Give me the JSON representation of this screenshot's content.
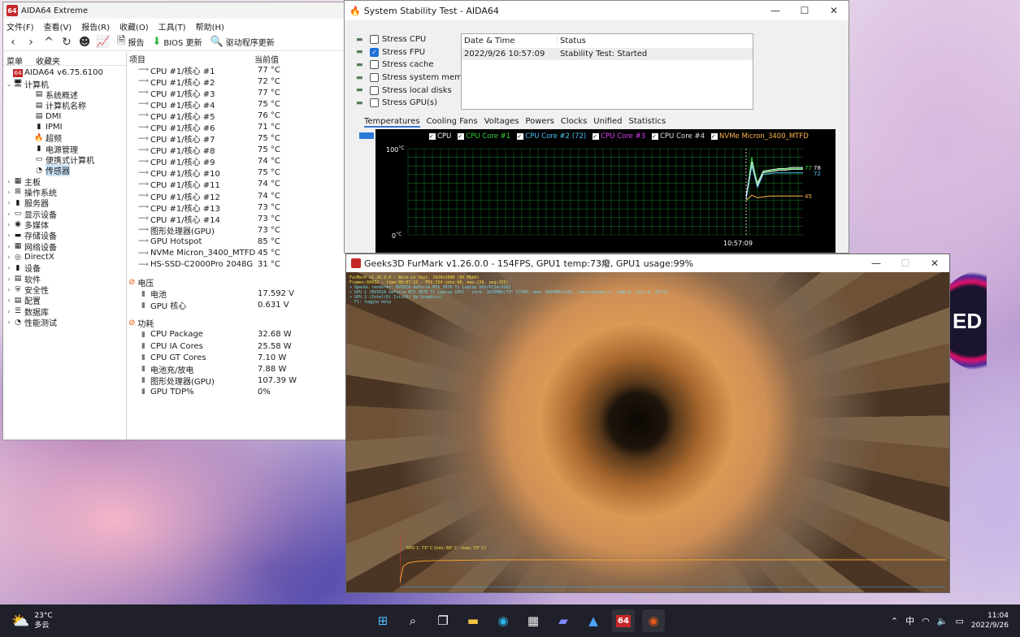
{
  "aida": {
    "title": "AIDA64 Extreme",
    "menu": [
      "文件(F)",
      "查看(V)",
      "报告(R)",
      "收藏(O)",
      "工具(T)",
      "帮助(H)"
    ],
    "toolbar": {
      "report": "报告",
      "bios": "BIOS 更新",
      "driver": "驱动程序更新"
    },
    "tabs": [
      "菜单",
      "收藏夹"
    ],
    "tree": [
      {
        "label": "AIDA64 v6.75.6100",
        "level": 0,
        "icon": "aida64-icon"
      },
      {
        "label": "计算机",
        "level": 0,
        "icon": "computer-icon",
        "expanded": true
      },
      {
        "label": "系统概述",
        "level": 1,
        "icon": "summary-icon"
      },
      {
        "label": "计算机名称",
        "level": 1,
        "icon": "computer-name-icon"
      },
      {
        "label": "DMI",
        "level": 1,
        "icon": "dmi-icon"
      },
      {
        "label": "IPMI",
        "level": 1,
        "icon": "ipmi-icon"
      },
      {
        "label": "超频",
        "level": 1,
        "icon": "overclock-icon"
      },
      {
        "label": "电源管理",
        "level": 1,
        "icon": "power-management-icon"
      },
      {
        "label": "便携式计算机",
        "level": 1,
        "icon": "laptop-icon"
      },
      {
        "label": "传感器",
        "level": 1,
        "icon": "sensor-icon",
        "selected": true
      },
      {
        "label": "主板",
        "level": 0,
        "icon": "motherboard-icon"
      },
      {
        "label": "操作系统",
        "level": 0,
        "icon": "windows-icon"
      },
      {
        "label": "服务器",
        "level": 0,
        "icon": "server-icon"
      },
      {
        "label": "显示设备",
        "level": 0,
        "icon": "display-icon"
      },
      {
        "label": "多媒体",
        "level": 0,
        "icon": "multimedia-icon"
      },
      {
        "label": "存储设备",
        "level": 0,
        "icon": "storage-icon"
      },
      {
        "label": "网络设备",
        "level": 0,
        "icon": "network-icon"
      },
      {
        "label": "DirectX",
        "level": 0,
        "icon": "directx-icon"
      },
      {
        "label": "设备",
        "level": 0,
        "icon": "devices-icon"
      },
      {
        "label": "软件",
        "level": 0,
        "icon": "software-icon"
      },
      {
        "label": "安全性",
        "level": 0,
        "icon": "security-icon"
      },
      {
        "label": "配置",
        "level": 0,
        "icon": "config-icon"
      },
      {
        "label": "数据库",
        "level": 0,
        "icon": "database-icon"
      },
      {
        "label": "性能测试",
        "level": 0,
        "icon": "benchmark-icon"
      }
    ],
    "columns": {
      "item": "项目",
      "value": "当前值"
    },
    "temps": [
      {
        "name": "CPU #1/核心 #1",
        "value": "77 °C"
      },
      {
        "name": "CPU #1/核心 #2",
        "value": "72 °C"
      },
      {
        "name": "CPU #1/核心 #3",
        "value": "77 °C"
      },
      {
        "name": "CPU #1/核心 #4",
        "value": "75 °C"
      },
      {
        "name": "CPU #1/核心 #5",
        "value": "76 °C"
      },
      {
        "name": "CPU #1/核心 #6",
        "value": "71 °C"
      },
      {
        "name": "CPU #1/核心 #7",
        "value": "75 °C"
      },
      {
        "name": "CPU #1/核心 #8",
        "value": "75 °C"
      },
      {
        "name": "CPU #1/核心 #9",
        "value": "74 °C"
      },
      {
        "name": "CPU #1/核心 #10",
        "value": "75 °C"
      },
      {
        "name": "CPU #1/核心 #11",
        "value": "74 °C"
      },
      {
        "name": "CPU #1/核心 #12",
        "value": "74 °C"
      },
      {
        "name": "CPU #1/核心 #13",
        "value": "73 °C"
      },
      {
        "name": "CPU #1/核心 #14",
        "value": "73 °C"
      },
      {
        "name": "图形处理器(GPU)",
        "value": "73 °C"
      },
      {
        "name": "GPU Hotspot",
        "value": "85 °C"
      },
      {
        "name": "NVMe Micron_3400_MTFD",
        "value": "45 °C"
      },
      {
        "name": "HS-SSD-C2000Pro 2048G",
        "value": "31 °C"
      }
    ],
    "voltage_section": "电压",
    "voltages": [
      {
        "name": "电池",
        "value": "17.592 V"
      },
      {
        "name": "GPU 核心",
        "value": "0.631 V"
      }
    ],
    "power_section": "功耗",
    "power": [
      {
        "name": "CPU Package",
        "value": "32.68 W"
      },
      {
        "name": "CPU IA Cores",
        "value": "25.58 W"
      },
      {
        "name": "CPU GT Cores",
        "value": "7.10 W"
      },
      {
        "name": "电池充/放电",
        "value": "7.88 W"
      },
      {
        "name": "图形处理器(GPU)",
        "value": "107.39 W"
      },
      {
        "name": "GPU TDP%",
        "value": "0%"
      }
    ]
  },
  "sst": {
    "title": "System Stability Test - AIDA64",
    "stress": [
      {
        "label": "Stress CPU",
        "checked": false
      },
      {
        "label": "Stress FPU",
        "checked": true
      },
      {
        "label": "Stress cache",
        "checked": false
      },
      {
        "label": "Stress system memory",
        "checked": false
      },
      {
        "label": "Stress local disks",
        "checked": false
      },
      {
        "label": "Stress GPU(s)",
        "checked": false
      }
    ],
    "table_headers": [
      "Date & Time",
      "Status"
    ],
    "table_row": [
      "2022/9/26 10:57:09",
      "Stability Test: Started"
    ],
    "tabs": [
      "Temperatures",
      "Cooling Fans",
      "Voltages",
      "Powers",
      "Clocks",
      "Unified",
      "Statistics"
    ],
    "legend": [
      {
        "label": "CPU",
        "color": "#ffffff"
      },
      {
        "label": "CPU Core #1",
        "color": "#36d43c"
      },
      {
        "label": "CPU Core #2 (72)",
        "color": "#4fc3f7"
      },
      {
        "label": "CPU Core #3",
        "color": "#e040fb"
      },
      {
        "label": "CPU Core #4",
        "color": "#e0e0e0"
      },
      {
        "label": "NVMe Micron_3400_MTFD",
        "color": "#ffb74d"
      }
    ],
    "chart": {
      "ytop": "100",
      "ybottom": "0",
      "unit": "°C",
      "time_label": "10:57:09",
      "end_values": [
        "77",
        "78",
        "72",
        "45"
      ]
    }
  },
  "furmark": {
    "title": "Geeks3D FurMark v1.26.0.0 - 154FPS, GPU1 temp:73癈, GPU1 usage:99%",
    "osd": [
      "FurMark v1.26.0.0 - Burn-in test, 1920x1080 (0X MSAA)",
      "Frames:60432 - time:00:07:22 - FPS:154 (min:96, max:158, avg:155)",
      "> OpenGL renderer: NVIDIA GeForce RTX 3070 Ti Laptop GPU/PCIe/SSE2",
      "> GPU 1 (NVIDIA GeForce RTX 3070 Ti Laptop GPU) - core: 1635MHz/73° C/99%, mem: 6001MHz/11%, limits[power:1, temp:0, volt:0, OV:0]",
      "> GPU 2 (Intel(R) Iris(R) Xe Graphics)",
      "- F1: toggle help"
    ],
    "graph_label": "GPU 1: 73° C (min: 68° C - max: 73° C)"
  },
  "taskbar": {
    "temperature": "23°C",
    "weather": "多云",
    "ime": "中",
    "time": "11:04",
    "date": "2022/9/26"
  }
}
